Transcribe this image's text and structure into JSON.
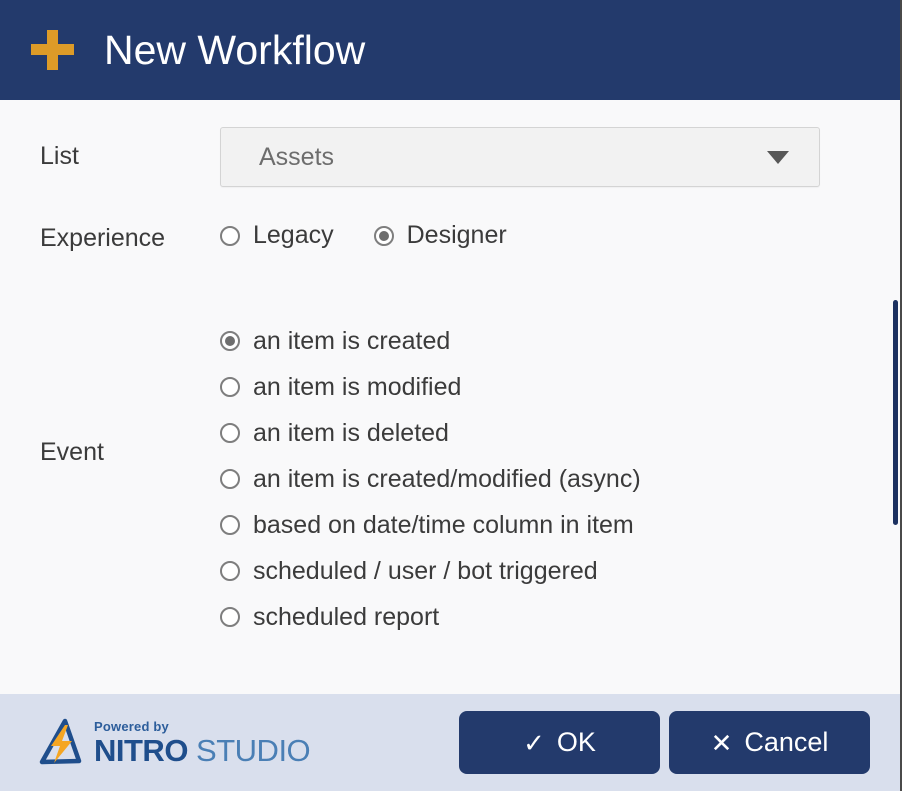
{
  "header": {
    "title": "New Workflow",
    "icon": "plus-icon",
    "background_color": "#233a6c",
    "icon_color": "#dd9b28"
  },
  "form": {
    "list": {
      "label": "List",
      "selected_value": "Assets",
      "caret_icon": "chevron-down-icon"
    },
    "experience": {
      "label": "Experience",
      "options": [
        {
          "label": "Legacy",
          "selected": false
        },
        {
          "label": "Designer",
          "selected": true
        }
      ]
    },
    "event": {
      "label": "Event",
      "options": [
        {
          "label": "an item is created",
          "selected": true
        },
        {
          "label": "an item is modified",
          "selected": false
        },
        {
          "label": "an item is deleted",
          "selected": false
        },
        {
          "label": "an item is created/modified (async)",
          "selected": false
        },
        {
          "label": "based on date/time column in item",
          "selected": false
        },
        {
          "label": "scheduled / user / bot triggered",
          "selected": false
        },
        {
          "label": "scheduled report",
          "selected": false
        }
      ]
    }
  },
  "footer": {
    "logo": {
      "powered_by": "Powered by",
      "brand_primary": "NITRO",
      "brand_secondary": " STUDIO",
      "mark_icon": "nitro-triangle-bolt-icon"
    },
    "ok_button": {
      "label": "OK",
      "glyph": "check-icon"
    },
    "cancel_button": {
      "label": "Cancel",
      "glyph": "close-icon"
    },
    "background_color": "#d9dfed",
    "button_color": "#233a6c"
  }
}
